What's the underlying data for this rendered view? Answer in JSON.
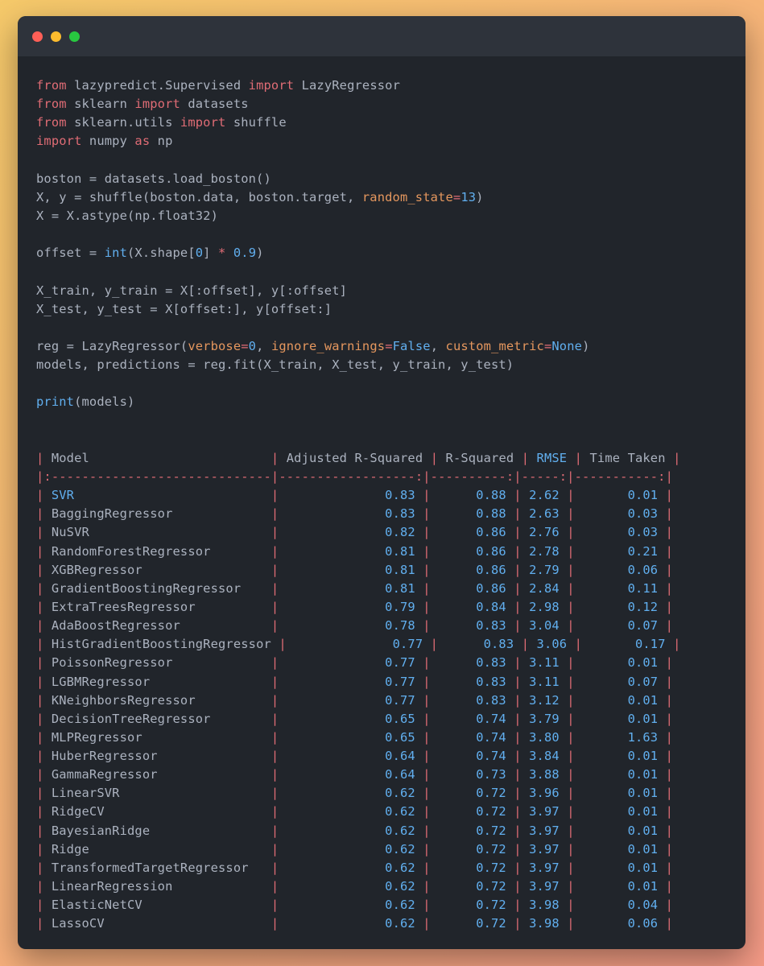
{
  "code_lines": [
    [
      {
        "t": "from",
        "c": "kw"
      },
      {
        "t": " lazypredict.Supervised ",
        "c": ""
      },
      {
        "t": "import",
        "c": "kw"
      },
      {
        "t": " LazyRegressor",
        "c": ""
      }
    ],
    [
      {
        "t": "from",
        "c": "kw"
      },
      {
        "t": " sklearn ",
        "c": ""
      },
      {
        "t": "import",
        "c": "kw"
      },
      {
        "t": " datasets",
        "c": ""
      }
    ],
    [
      {
        "t": "from",
        "c": "kw"
      },
      {
        "t": " sklearn.utils ",
        "c": ""
      },
      {
        "t": "import",
        "c": "kw"
      },
      {
        "t": " shuffle",
        "c": ""
      }
    ],
    [
      {
        "t": "import",
        "c": "kw"
      },
      {
        "t": " numpy ",
        "c": ""
      },
      {
        "t": "as",
        "c": "kw"
      },
      {
        "t": " np",
        "c": ""
      }
    ],
    [],
    [
      {
        "t": "boston = datasets.load_boston()",
        "c": ""
      }
    ],
    [
      {
        "t": "X, y = shuffle(boston.data, boston.target, ",
        "c": ""
      },
      {
        "t": "random_state",
        "c": "kwa"
      },
      {
        "t": "=",
        "c": "kw"
      },
      {
        "t": "13",
        "c": "num"
      },
      {
        "t": ")",
        "c": ""
      }
    ],
    [
      {
        "t": "X = X.astype(np.float32)",
        "c": ""
      }
    ],
    [],
    [
      {
        "t": "offset = ",
        "c": ""
      },
      {
        "t": "int",
        "c": "fn"
      },
      {
        "t": "(X.shape[",
        "c": ""
      },
      {
        "t": "0",
        "c": "num"
      },
      {
        "t": "] ",
        "c": ""
      },
      {
        "t": "*",
        "c": "kw"
      },
      {
        "t": " ",
        "c": ""
      },
      {
        "t": "0.9",
        "c": "num"
      },
      {
        "t": ")",
        "c": ""
      }
    ],
    [],
    [
      {
        "t": "X_train, y_train = X[:offset], y[:offset]",
        "c": ""
      }
    ],
    [
      {
        "t": "X_test, y_test = X[offset:], y[offset:]",
        "c": ""
      }
    ],
    [],
    [
      {
        "t": "reg = LazyRegressor(",
        "c": ""
      },
      {
        "t": "verbose",
        "c": "kwa"
      },
      {
        "t": "=",
        "c": "kw"
      },
      {
        "t": "0",
        "c": "num"
      },
      {
        "t": ", ",
        "c": ""
      },
      {
        "t": "ignore_warnings",
        "c": "kwa"
      },
      {
        "t": "=",
        "c": "kw"
      },
      {
        "t": "False",
        "c": "num"
      },
      {
        "t": ", ",
        "c": ""
      },
      {
        "t": "custom_metric",
        "c": "kwa"
      },
      {
        "t": "=",
        "c": "kw"
      },
      {
        "t": "None",
        "c": "num"
      },
      {
        "t": ")",
        "c": ""
      }
    ],
    [
      {
        "t": "models, predictions = reg.fit(X_train, X_test, y_train, y_test)",
        "c": ""
      }
    ],
    [],
    [
      {
        "t": "print",
        "c": "fn"
      },
      {
        "t": "(models)",
        "c": ""
      }
    ]
  ],
  "table": {
    "headers": [
      "Model",
      "Adjusted R-Squared",
      "R-Squared",
      "RMSE",
      "Time Taken"
    ],
    "widths": [
      30,
      19,
      11,
      6,
      12
    ],
    "align": [
      "left",
      "right",
      "right",
      "right",
      "right"
    ],
    "rows": [
      [
        "SVR",
        "0.83",
        "0.88",
        "2.62",
        "0.01"
      ],
      [
        "BaggingRegressor",
        "0.83",
        "0.88",
        "2.63",
        "0.03"
      ],
      [
        "NuSVR",
        "0.82",
        "0.86",
        "2.76",
        "0.03"
      ],
      [
        "RandomForestRegressor",
        "0.81",
        "0.86",
        "2.78",
        "0.21"
      ],
      [
        "XGBRegressor",
        "0.81",
        "0.86",
        "2.79",
        "0.06"
      ],
      [
        "GradientBoostingRegressor",
        "0.81",
        "0.86",
        "2.84",
        "0.11"
      ],
      [
        "ExtraTreesRegressor",
        "0.79",
        "0.84",
        "2.98",
        "0.12"
      ],
      [
        "AdaBoostRegressor",
        "0.78",
        "0.83",
        "3.04",
        "0.07"
      ],
      [
        "HistGradientBoostingRegressor",
        "0.77",
        "0.83",
        "3.06",
        "0.17"
      ],
      [
        "PoissonRegressor",
        "0.77",
        "0.83",
        "3.11",
        "0.01"
      ],
      [
        "LGBMRegressor",
        "0.77",
        "0.83",
        "3.11",
        "0.07"
      ],
      [
        "KNeighborsRegressor",
        "0.77",
        "0.83",
        "3.12",
        "0.01"
      ],
      [
        "DecisionTreeRegressor",
        "0.65",
        "0.74",
        "3.79",
        "0.01"
      ],
      [
        "MLPRegressor",
        "0.65",
        "0.74",
        "3.80",
        "1.63"
      ],
      [
        "HuberRegressor",
        "0.64",
        "0.74",
        "3.84",
        "0.01"
      ],
      [
        "GammaRegressor",
        "0.64",
        "0.73",
        "3.88",
        "0.01"
      ],
      [
        "LinearSVR",
        "0.62",
        "0.72",
        "3.96",
        "0.01"
      ],
      [
        "RidgeCV",
        "0.62",
        "0.72",
        "3.97",
        "0.01"
      ],
      [
        "BayesianRidge",
        "0.62",
        "0.72",
        "3.97",
        "0.01"
      ],
      [
        "Ridge",
        "0.62",
        "0.72",
        "3.97",
        "0.01"
      ],
      [
        "TransformedTargetRegressor",
        "0.62",
        "0.72",
        "3.97",
        "0.01"
      ],
      [
        "LinearRegression",
        "0.62",
        "0.72",
        "3.97",
        "0.01"
      ],
      [
        "ElasticNetCV",
        "0.62",
        "0.72",
        "3.98",
        "0.04"
      ],
      [
        "LassoCV",
        "0.62",
        "0.72",
        "3.98",
        "0.06"
      ]
    ]
  },
  "colors": {
    "window_bg": "#21252b",
    "titlebar_bg": "#2e333b",
    "keyword": "#e06c75",
    "function": "#61afef",
    "argument": "#e5975e",
    "text": "#abb2bf"
  }
}
